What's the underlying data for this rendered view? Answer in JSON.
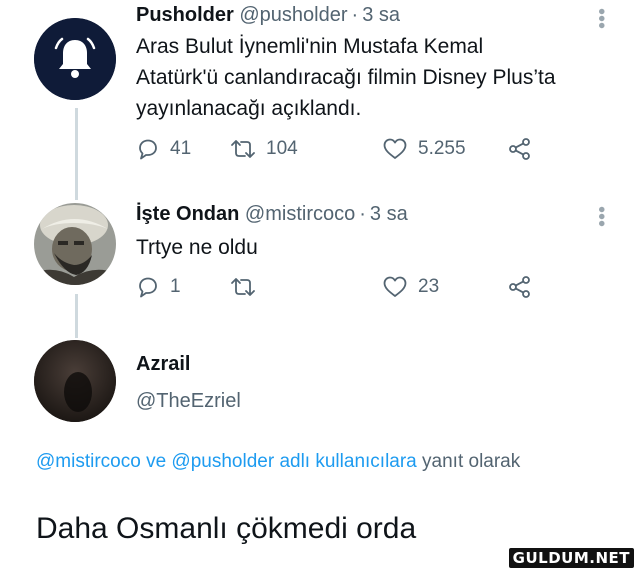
{
  "tweet1": {
    "name": "Pusholder",
    "handle": "@pusholder",
    "time": "3 sa",
    "text_lines": [
      "Aras Bulut İynemli'nin Mustafa Kemal",
      "Atatürk'ü canlandıracağı filmin Disney Plus’ta",
      "yayınlanacağı açıklandı."
    ],
    "replies": "41",
    "retweets": "104",
    "likes": "5.255",
    "avatar_icon": "bell-icon"
  },
  "tweet2": {
    "name": "İşte Ondan",
    "handle": "@mistircoco",
    "time": "3 sa",
    "text": "Trtye ne oldu",
    "replies": "1",
    "retweets": "",
    "likes": "23"
  },
  "tweet3": {
    "name": "Azrail",
    "handle": "@TheEzriel",
    "reply_handle_1": "@mistircoco",
    "reply_and": " ve ",
    "reply_handle_2": "@pusholder",
    "reply_suffix_link": " adlı kullanıcılara",
    "reply_suffix": " yanıt olarak",
    "text": "Daha Osmanlı çökmedi orda"
  },
  "watermark": "GULDUM.NET",
  "colors": {
    "link": "#1d9bf0",
    "muted": "#536471",
    "thread_line": "#cfd9de",
    "text": "#0f1419"
  }
}
